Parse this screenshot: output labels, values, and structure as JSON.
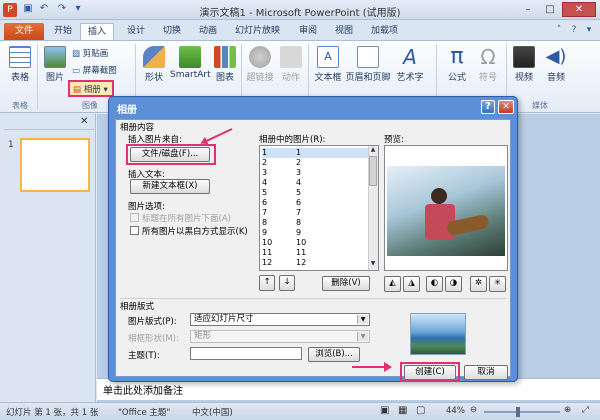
{
  "window": {
    "title": "演示文稿1 - Microsoft PowerPoint (试用版)",
    "qat": [
      "save-icon",
      "undo-icon",
      "redo-icon",
      "customize-icon"
    ]
  },
  "tabs": [
    "文件",
    "开始",
    "插入",
    "设计",
    "切换",
    "动画",
    "幻灯片放映",
    "审阅",
    "视图",
    "加载项"
  ],
  "ribbon": {
    "table": "表格",
    "picture": "图片",
    "clipart": "剪贴画",
    "screenshot": "屏幕截图",
    "album": "相册",
    "shapes": "形状",
    "smartart": "SmartArt",
    "chart": "图表",
    "hyperlink": "超链接",
    "action": "动作",
    "textbox": "文本框",
    "headerfooter": "页眉和页脚",
    "wordart": "艺术字",
    "equation": "公式",
    "symbol": "符号",
    "video": "视频",
    "audio": "音频",
    "groups": {
      "tables": "表格",
      "images": "图像",
      "media": "媒体"
    }
  },
  "slide_panel": {
    "slide_number": "1"
  },
  "notes": "单击此处添加备注",
  "status": {
    "slide": "幻灯片 第 1 张，共 1 张",
    "theme": "\"Office 主题\"",
    "lang": "中文(中国)",
    "zoom": "44%"
  },
  "dialog": {
    "title": "相册",
    "help": "?",
    "section_content": "相册内容",
    "insert_from": "插入图片来自:",
    "file_button": "文件/磁盘(F)...",
    "insert_text": "插入文本:",
    "new_textbox": "新建文本框(X)",
    "pic_options": "图片选项:",
    "opt_caption": "标题在所有图片下面(A)",
    "opt_bw": "所有图片以黑白方式显示(K)",
    "list_label": "相册中的图片(R):",
    "preview_label": "预览:",
    "list_rows": [
      [
        "1",
        "1"
      ],
      [
        "2",
        "2"
      ],
      [
        "3",
        "3"
      ],
      [
        "4",
        "4"
      ],
      [
        "5",
        "5"
      ],
      [
        "6",
        "6"
      ],
      [
        "7",
        "7"
      ],
      [
        "8",
        "8"
      ],
      [
        "9",
        "9"
      ],
      [
        "10",
        "10"
      ],
      [
        "11",
        "11"
      ],
      [
        "12",
        "12"
      ]
    ],
    "up": "↑",
    "down": "↓",
    "delete": "删除(V)",
    "section_layout": "相册版式",
    "layout_label": "图片版式(P):",
    "layout_value": "适应幻灯片尺寸",
    "frame_label": "相框形状(M):",
    "frame_value": "矩形",
    "theme_label": "主题(T):",
    "theme_value": "",
    "browse": "浏览(B)...",
    "create": "创建(C)",
    "cancel": "取消"
  },
  "colors": {
    "accent": "#e0307a",
    "file_tab": "#d05a22",
    "dialog_frame": "#5b8fd6"
  }
}
